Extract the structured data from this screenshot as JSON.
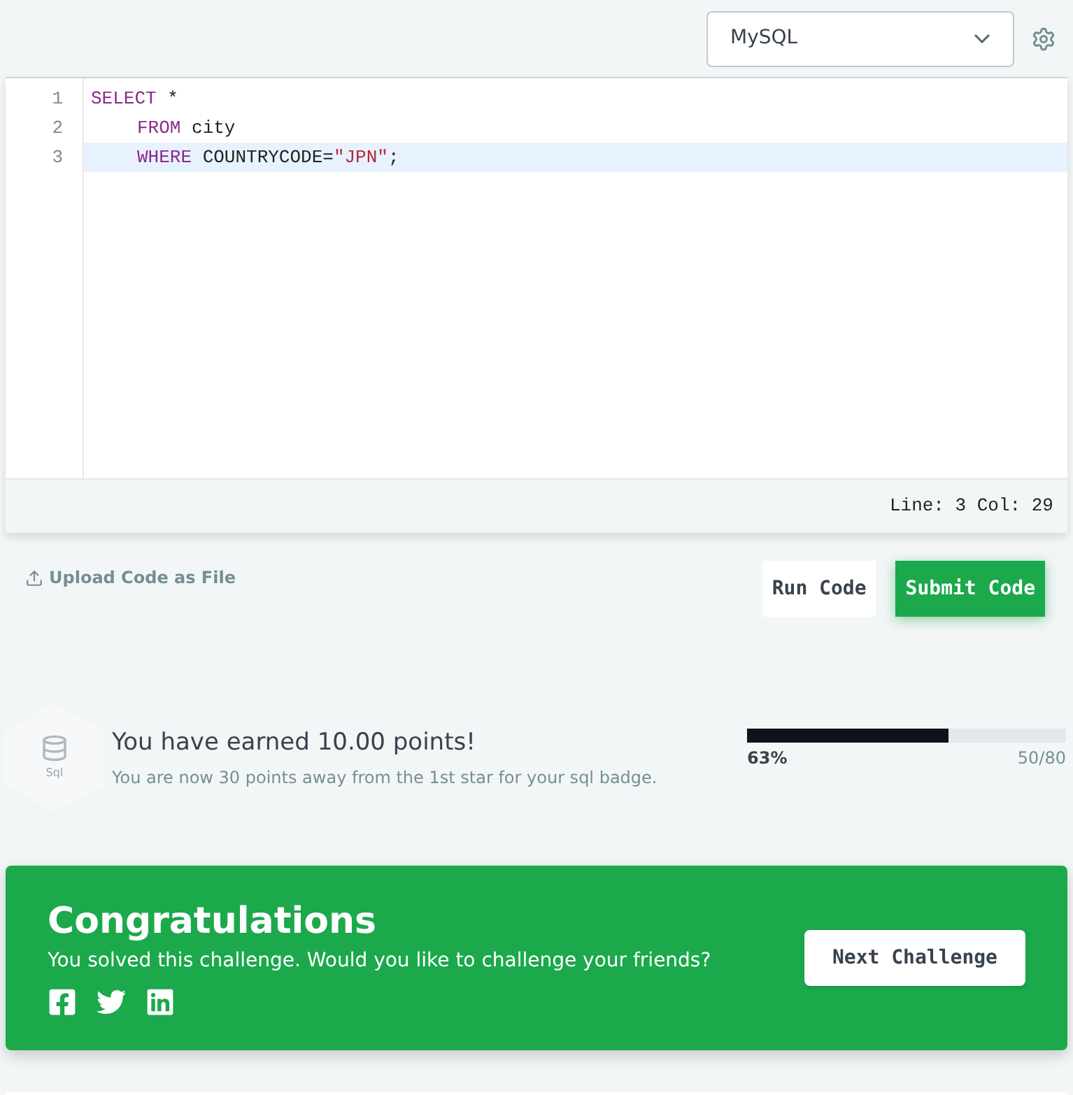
{
  "language_select": {
    "value": "MySQL"
  },
  "editor": {
    "lines": [
      {
        "number": "1",
        "active": false,
        "tokens": [
          {
            "kind": "keyword",
            "text": "SELECT"
          },
          {
            "kind": "plain",
            "text": " *"
          }
        ]
      },
      {
        "number": "2",
        "active": false,
        "indented": true,
        "tokens": [
          {
            "kind": "keyword",
            "text": "FROM"
          },
          {
            "kind": "plain",
            "text": " city"
          }
        ]
      },
      {
        "number": "3",
        "active": true,
        "indented": true,
        "tokens": [
          {
            "kind": "keyword",
            "text": "WHERE"
          },
          {
            "kind": "plain",
            "text": " COUNTRYCODE="
          },
          {
            "kind": "string",
            "text": "\"JPN\""
          },
          {
            "kind": "plain",
            "text": ";"
          }
        ]
      }
    ],
    "status": "Line: 3 Col: 29"
  },
  "upload_link": "Upload Code as File",
  "buttons": [
    {
      "label": "Run Code",
      "kind": "secondary"
    },
    {
      "label": "Submit Code",
      "kind": "primary"
    }
  ],
  "result": {
    "badge_label": "Sql",
    "title": "You have earned 10.00 points!",
    "subtitle": "You are now 30 points away from the 1st star for your sql badge.",
    "progress": {
      "level": 0.63,
      "percent": "63%",
      "count": "50/80"
    }
  },
  "congrats": {
    "title": "Congratulations",
    "message": "You solved this challenge. Would you like to challenge your friends?",
    "button": "Next Challenge"
  }
}
